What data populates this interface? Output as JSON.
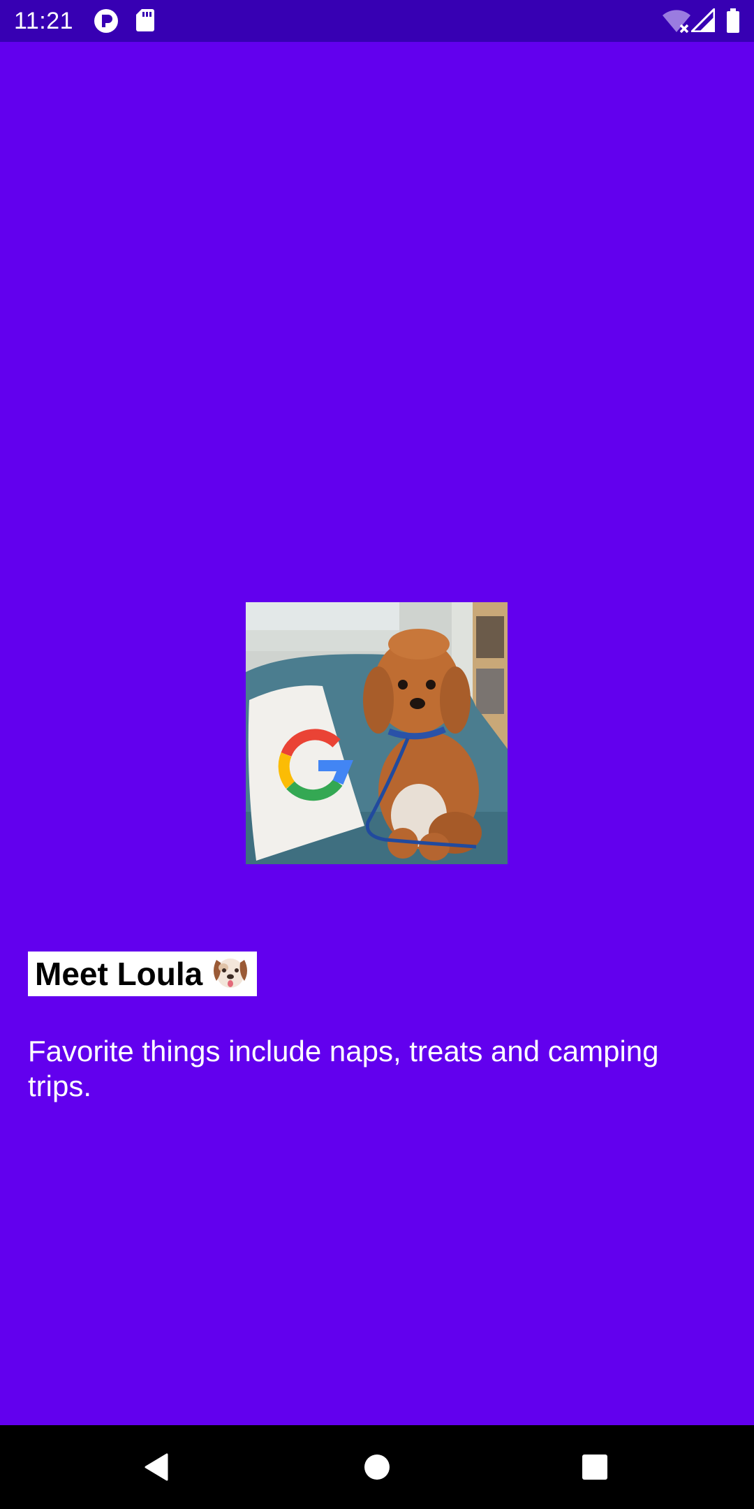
{
  "status_bar": {
    "time": "11:21",
    "left_icons": [
      "app-notification-icon",
      "sd-card-icon"
    ],
    "right_icons": [
      "wifi-off-icon",
      "cell-signal-icon",
      "battery-icon"
    ],
    "background_color": "#3700B3"
  },
  "main": {
    "background_color": "#6200EE",
    "photo": {
      "subject": "dog-photo"
    },
    "title": "Meet Loula",
    "title_emoji": "dog-face-emoji",
    "description": "Favorite things include naps, treats and camping trips."
  },
  "nav_bar": {
    "buttons": [
      "back-button",
      "home-button",
      "recents-button"
    ]
  }
}
